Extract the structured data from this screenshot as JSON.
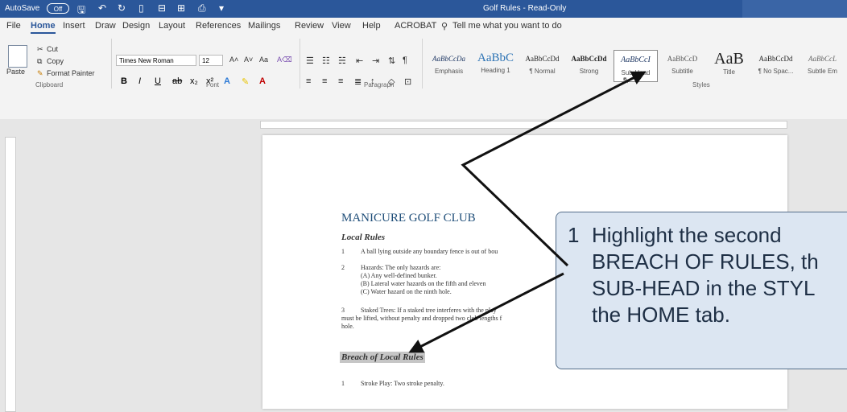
{
  "titlebar": {
    "autosave": "AutoSave",
    "toggle": "Off",
    "title": "Golf Rules  -  Read-Only"
  },
  "tabs": [
    "File",
    "Home",
    "Insert",
    "Draw",
    "Design",
    "Layout",
    "References",
    "Mailings",
    "Review",
    "View",
    "Help",
    "ACROBAT"
  ],
  "tell_me": "Tell me what you want to do",
  "clipboard": {
    "paste": "Paste",
    "cut": "Cut",
    "copy": "Copy",
    "format_painter": "Format Painter",
    "label": "Clipboard"
  },
  "font": {
    "name": "Times New Roman",
    "size": "12",
    "label": "Font"
  },
  "paragraph": {
    "label": "Paragraph"
  },
  "styles": {
    "label": "Styles",
    "items": [
      {
        "preview": "AaBbCcDa",
        "name": "Emphasis"
      },
      {
        "preview": "AaBbC",
        "name": "Heading 1"
      },
      {
        "preview": "AaBbCcDd",
        "name": "¶ Normal"
      },
      {
        "preview": "AaBbCcDd",
        "name": "Strong"
      },
      {
        "preview": "AaBbCcI",
        "name": "Sub-Head"
      },
      {
        "preview": "AaBbCcD",
        "name": "Subtitle"
      },
      {
        "preview": "AaB",
        "name": "Title"
      },
      {
        "preview": "AaBbCcDd",
        "name": "¶ No Spac..."
      },
      {
        "preview": "AaBbCcL",
        "name": "Subtle Em"
      }
    ]
  },
  "document": {
    "title": "MANICURE GOLF CLUB",
    "local_rules": "Local Rules",
    "rule1_num": "1",
    "rule1": "A ball lying outside any boundary fence is out of bou",
    "rule2_num": "2",
    "rule2": "Hazards:  The only hazards are:",
    "rule2a": "(A)       Any well-defined bunker.",
    "rule2b": "(B)       Lateral water hazards on the fifth and eleven",
    "rule2c": "(C)       Water hazard on the ninth hole.",
    "rule3_num": "3",
    "rule3": "Staked Trees:  If a staked tree interferes with the play",
    "rule3b": "must be lifted, without penalty and dropped two club lengths f",
    "rule3c": "hole.",
    "breach": "Breach of Local Rules",
    "breach1_num": "1",
    "breach1": "Stroke Play:  Two stroke penalty."
  },
  "callout": {
    "number": "1",
    "lines": [
      "Highlight the second",
      "BREACH OF RULES, th",
      "SUB-HEAD in the STYL",
      "the HOME tab."
    ]
  },
  "colors": {
    "titlebar": "#2b579a",
    "callout_bg": "#dce6f2",
    "heading": "#1f4e79"
  }
}
